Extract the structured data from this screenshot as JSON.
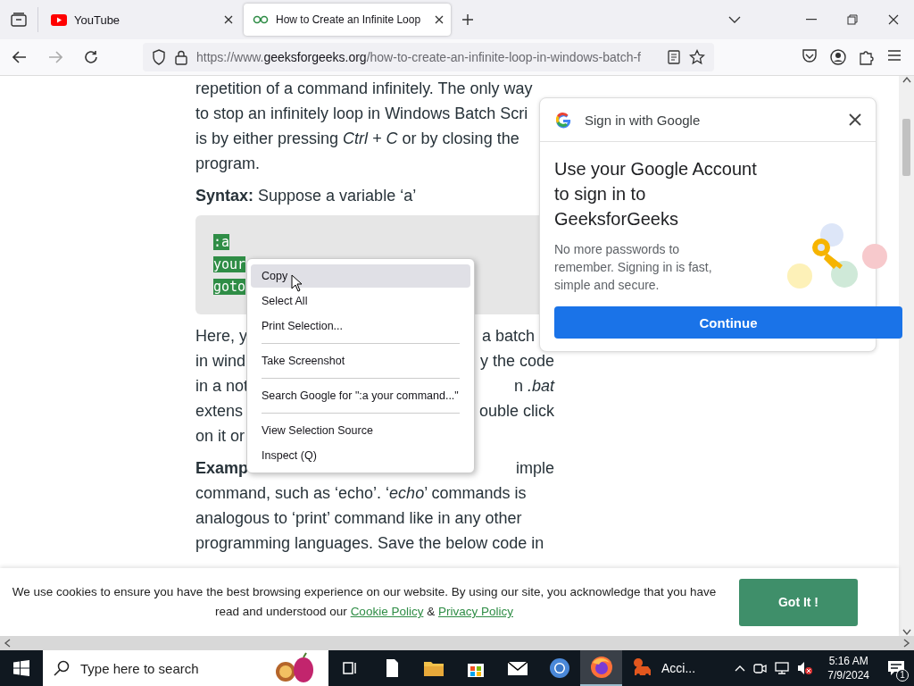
{
  "tabs": [
    {
      "title": "YouTube",
      "selected": false
    },
    {
      "title": "How to Create an Infinite Loop",
      "selected": true
    }
  ],
  "address_bar": {
    "prefix": "https://www.",
    "domain": "geeksforgeeks.org",
    "path": "/how-to-create-an-infinite-loop-in-windows-batch-f"
  },
  "article": {
    "lines_before": [
      "repetition of a command infinitely. The only way",
      "to stop an infinitely loop in Windows Batch Scri",
      "is by either pressing *Ctrl + C* or by closing the",
      "program."
    ],
    "syntax": "**Syntax:** Suppose a variable ‘a’",
    "code_lines": [
      ":a",
      "your",
      "goto"
    ],
    "split_lines": [
      {
        "left": "Here, y",
        "right": "a batch"
      },
      {
        "left": "in wind",
        "right": "y the code"
      },
      {
        "left": "in a not",
        "right": "n *.bat*"
      },
      {
        "left": "extens",
        "right": "ouble click"
      },
      {
        "left": "on it or"
      }
    ],
    "example_line": {
      "left": "**Examp**",
      "right": "imple"
    },
    "lines_after": [
      "command, such as ‘echo’. ‘*echo*’ commands is",
      "analogous to ‘print’ command like in any other",
      "programming languages. Save the below code in"
    ]
  },
  "context_menu": [
    {
      "kind": "item",
      "label": "Copy",
      "selected": true
    },
    {
      "kind": "item",
      "label": "Select All",
      "selected": false
    },
    {
      "kind": "item",
      "label": "Print Selection...",
      "selected": false
    },
    {
      "kind": "separator"
    },
    {
      "kind": "item",
      "label": "Take Screenshot",
      "selected": false
    },
    {
      "kind": "separator"
    },
    {
      "kind": "item",
      "label": "Search Google for \":a your command...\"",
      "selected": false
    },
    {
      "kind": "separator"
    },
    {
      "kind": "item",
      "label": "View Selection Source",
      "selected": false
    },
    {
      "kind": "item",
      "label": "Inspect (Q)",
      "selected": false
    }
  ],
  "google_signin": {
    "title": "Sign in with Google",
    "heading": "Use your Google Account to sign in to GeeksforGeeks",
    "body": "No more passwords to remember. Signing in is fast, simple and secure.",
    "button": "Continue"
  },
  "cookie_banner": {
    "text": "We use cookies to ensure you have the best browsing experience on our website. By using our site, you acknowledge that you have read and understood our",
    "links": [
      "Cookie Policy",
      "Privacy Policy"
    ],
    "joiner": "&",
    "button": "Got It !"
  },
  "taskbar": {
    "search_placeholder": "Type here to search",
    "apps": [
      {
        "selected": false
      },
      {
        "selected": false
      },
      {
        "selected": false
      },
      {
        "selected": false
      },
      {
        "selected": false
      },
      {
        "selected": false
      },
      {
        "selected": true
      }
    ],
    "labeled_app": {
      "label": "Acci...",
      "selected": false
    },
    "time": "5:16 AM",
    "date": "7/9/2024",
    "notifications": "1"
  }
}
